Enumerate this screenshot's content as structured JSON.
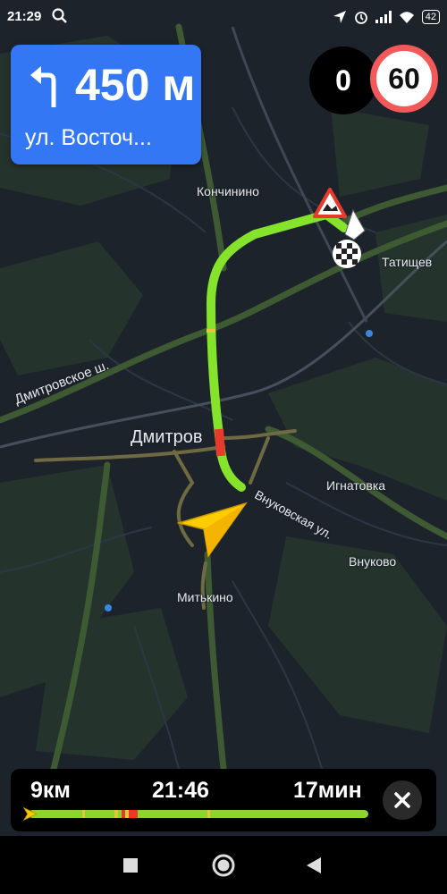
{
  "status_bar": {
    "time": "21:29",
    "battery": "42"
  },
  "maneuver": {
    "distance": "450 м",
    "street": "ул. Восточ..."
  },
  "speed": {
    "current": "0",
    "limit": "60",
    "limit_ring_color": "#f35958"
  },
  "map": {
    "labels": [
      "Кончинино",
      "Татищев",
      "Дмитровское ш.",
      "Дмитров",
      "Игнатовка",
      "Внуковская ул.",
      "Внуково",
      "Митькино"
    ],
    "route_color": "#86e32b",
    "jam_color": "#e63a2c"
  },
  "route_panel": {
    "distance": "9км",
    "arrival": "21:46",
    "duration": "17мин",
    "progress": 0.0
  },
  "icons": {
    "turn": "turn-left-icon",
    "arrow": "navigation-arrow-icon",
    "finish": "finish-flag-icon",
    "warning": "road-warning-icon",
    "close": "close-icon"
  }
}
